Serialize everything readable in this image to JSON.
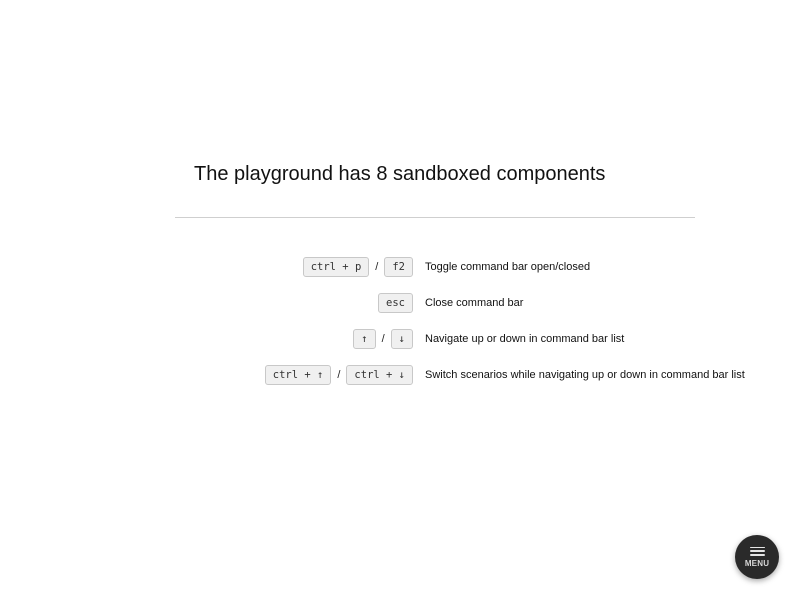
{
  "title": "The playground has 8 sandboxed components",
  "shortcuts": [
    {
      "keys": [
        "ctrl + p",
        "f2"
      ],
      "separator": "/",
      "description": "Toggle command bar open/closed"
    },
    {
      "keys": [
        "esc"
      ],
      "description": "Close command bar"
    },
    {
      "keys": [
        "↑",
        "↓"
      ],
      "separator": "/",
      "description": "Navigate up or down in command bar list"
    },
    {
      "keys": [
        "ctrl + ↑",
        "ctrl + ↓"
      ],
      "separator": "/",
      "description": "Switch scenarios while navigating up or down in command bar list"
    }
  ],
  "menu_button": {
    "label": "MENU",
    "icon": "hamburger-icon"
  }
}
